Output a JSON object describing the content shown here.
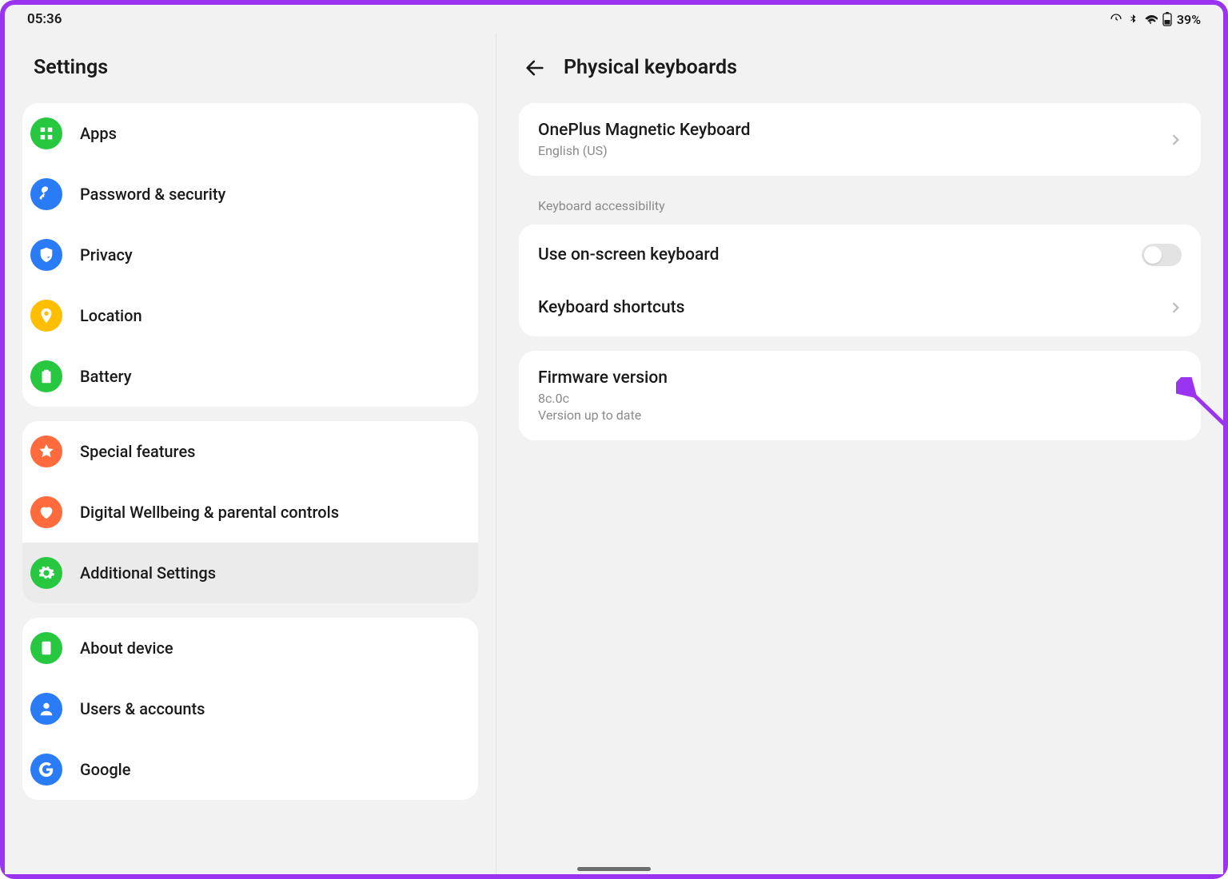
{
  "status": {
    "time": "05:36",
    "battery": "39%"
  },
  "sidebar": {
    "title": "Settings",
    "groups": [
      {
        "items": [
          {
            "label": "Apps",
            "color": "#27C840",
            "icon": "apps"
          },
          {
            "label": "Password & security",
            "color": "#2A7BF6",
            "icon": "key"
          },
          {
            "label": "Privacy",
            "color": "#2A7BF6",
            "icon": "shield"
          },
          {
            "label": "Location",
            "color": "#FFBF00",
            "icon": "pin"
          },
          {
            "label": "Battery",
            "color": "#27C840",
            "icon": "battery"
          }
        ]
      },
      {
        "items": [
          {
            "label": "Special features",
            "color": "#FF6B3D",
            "icon": "star"
          },
          {
            "label": "Digital Wellbeing & parental controls",
            "color": "#FF6B3D",
            "icon": "heart"
          },
          {
            "label": "Additional Settings",
            "color": "#27C840",
            "icon": "gear",
            "selected": true
          }
        ]
      },
      {
        "items": [
          {
            "label": "About device",
            "color": "#27C840",
            "icon": "tablet"
          },
          {
            "label": "Users & accounts",
            "color": "#2A7BF6",
            "icon": "person"
          },
          {
            "label": "Google",
            "color": "#2A7BF6",
            "icon": "google"
          }
        ]
      }
    ]
  },
  "detail": {
    "title": "Physical keyboards",
    "device": {
      "name": "OnePlus Magnetic Keyboard",
      "lang": "English (US)"
    },
    "accessibility_header": "Keyboard accessibility",
    "onscreen_label": "Use on-screen keyboard",
    "onscreen_toggle": false,
    "shortcuts_label": "Keyboard shortcuts",
    "firmware": {
      "title": "Firmware version",
      "version": "8c.0c",
      "status": "Version up to date"
    }
  }
}
